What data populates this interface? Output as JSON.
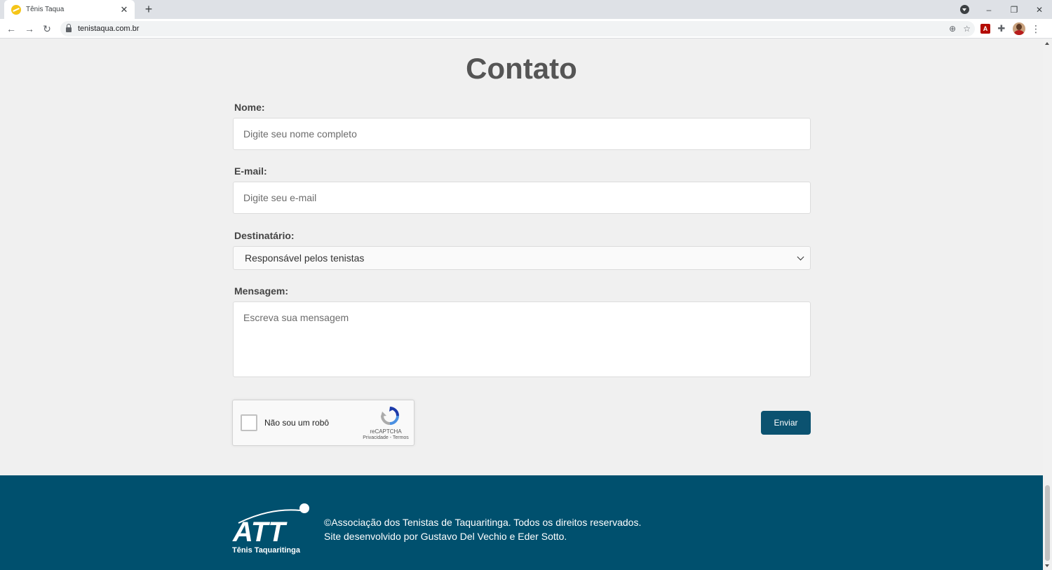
{
  "browser": {
    "tab_title": "Tênis Taqua",
    "tab_close": "✕",
    "new_tab": "+",
    "url": "tenistaqua.com.br",
    "nav": {
      "back": "←",
      "forward": "→",
      "reload": "↻"
    },
    "omnibox_icons": {
      "zoom": "⊕",
      "star": "☆"
    },
    "window": {
      "minimize": "–",
      "restore": "❐",
      "close": "✕"
    },
    "extensions": {
      "pdf": "A",
      "puzzle": "✚",
      "menu": "⋮"
    }
  },
  "page": {
    "heading": "Contato",
    "form": {
      "name_label": "Nome:",
      "name_placeholder": "Digite seu nome completo",
      "email_label": "E-mail:",
      "email_placeholder": "Digite seu e-mail",
      "recipient_label": "Destinatário:",
      "recipient_selected": "Responsável pelos tenistas",
      "message_label": "Mensagem:",
      "message_placeholder": "Escreva sua mensagem",
      "submit_label": "Enviar"
    },
    "recaptcha": {
      "checkbox_label": "Não sou um robô",
      "brand": "reCAPTCHA",
      "links": "Privacidade - Termos"
    }
  },
  "footer": {
    "logo_text": "ATT",
    "logo_subtitle": "Tênis Taquaritinga",
    "copyright": "©Associação dos Tenistas de Taquaritinga. Todos os direitos reservados.",
    "credits": "Site desenvolvido por Gustavo Del Vechio e Eder Sotto."
  },
  "colors": {
    "primary": "#0b5270",
    "footer_bg": "#00506e",
    "page_bg": "#f0f0f0",
    "heading": "#555555",
    "logo_ball": "#ffffff"
  }
}
